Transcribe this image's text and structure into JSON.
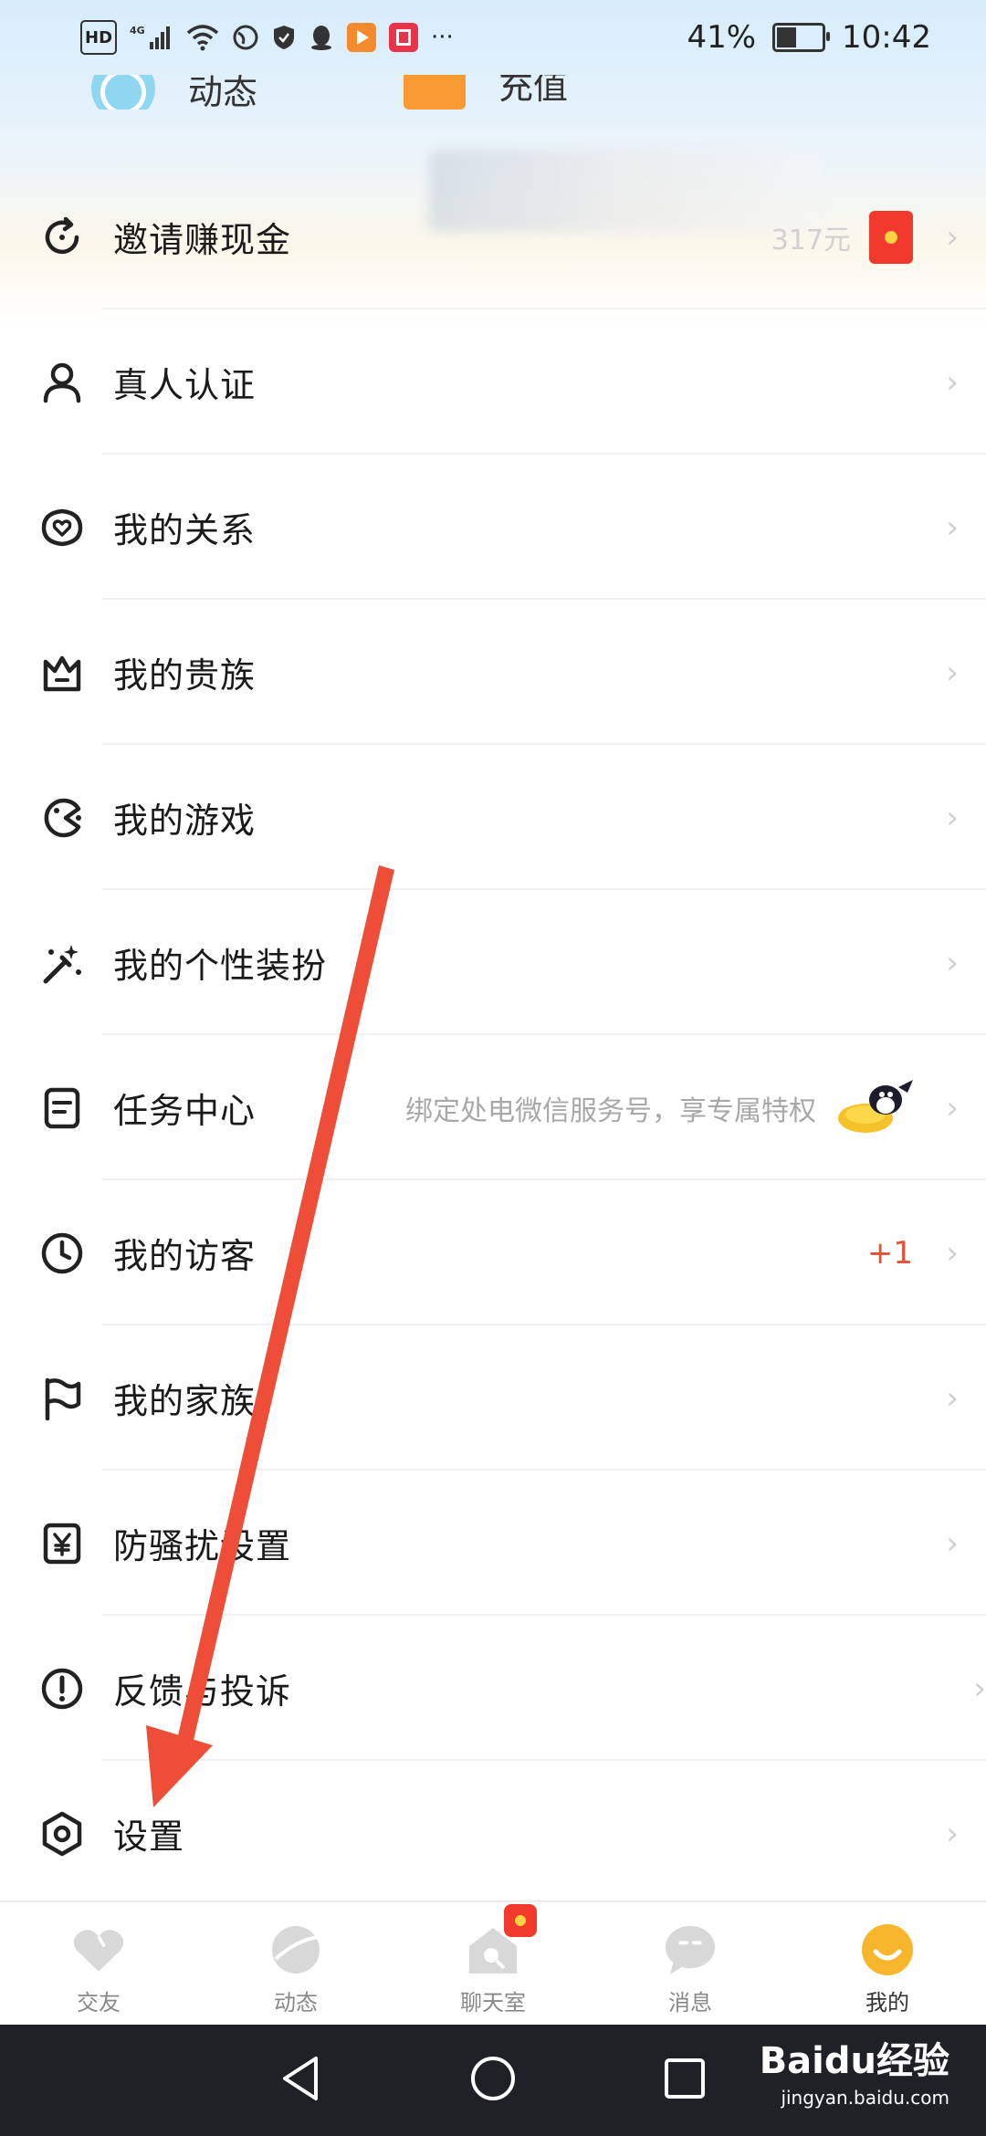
{
  "status_bar": {
    "hd": "HD",
    "net": "4G",
    "battery_text": "41%",
    "battery_level": 0.41,
    "time": "10:42",
    "more": "···"
  },
  "shortcuts": {
    "dynamic_label": "动态",
    "recharge_label": "充值"
  },
  "menu": {
    "items": [
      {
        "label": "邀请赚现金",
        "icon": "refresh-icon",
        "extra": "317元"
      },
      {
        "label": "真人认证",
        "icon": "person-icon"
      },
      {
        "label": "我的关系",
        "icon": "heart-relation-icon"
      },
      {
        "label": "我的贵族",
        "icon": "crown-icon"
      },
      {
        "label": "我的游戏",
        "icon": "game-icon"
      },
      {
        "label": "我的个性装扮",
        "icon": "magic-wand-icon"
      },
      {
        "label": "任务中心",
        "icon": "task-icon",
        "extra": "绑定处电微信服务号，享专属特权"
      },
      {
        "label": "我的访客",
        "icon": "clock-icon",
        "extra": "+1"
      },
      {
        "label": "我的家族",
        "icon": "flag-icon"
      },
      {
        "label": "防骚扰设置",
        "icon": "yen-shield-icon"
      },
      {
        "label": "反馈与投诉",
        "icon": "exclamation-icon"
      },
      {
        "label": "设置",
        "icon": "settings-icon"
      }
    ],
    "chevron": "›"
  },
  "tabbar": {
    "tabs": [
      {
        "label": "交友",
        "icon": "heart-tab-icon"
      },
      {
        "label": "动态",
        "icon": "planet-tab-icon"
      },
      {
        "label": "聊天室",
        "icon": "house-tab-icon"
      },
      {
        "label": "消息",
        "icon": "message-tab-icon"
      },
      {
        "label": "我的",
        "icon": "smile-tab-icon"
      }
    ]
  },
  "watermark": {
    "main": "Baidu经验",
    "sub": "jingyan.baidu.com"
  },
  "colors": {
    "accent_red": "#e0533b",
    "arrow_red": "#ee4d37",
    "tab_active": "#f7b52c"
  }
}
